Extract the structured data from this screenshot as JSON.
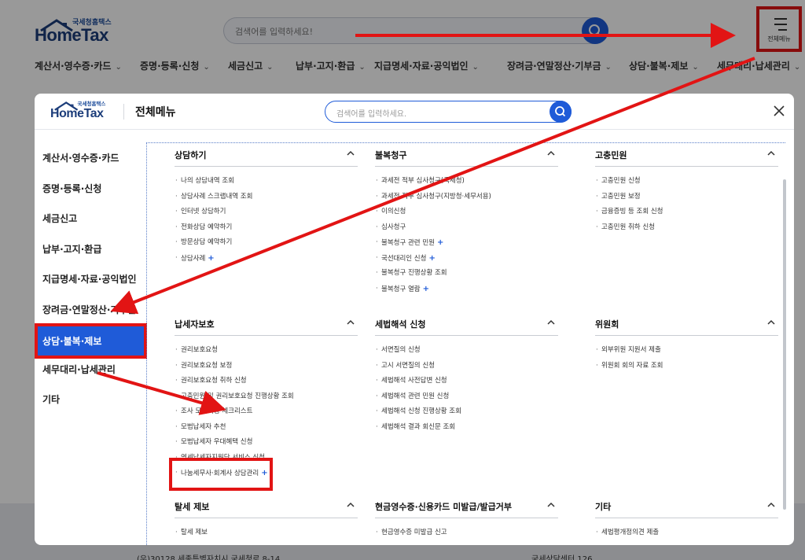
{
  "header": {
    "logo_top": "국세청홈택스",
    "logo_main": "HomeTax",
    "search_placeholder": "검색어를 입력하세요!",
    "menu_label": "전체메뉴"
  },
  "gnb": [
    {
      "label": "계산서·영수증·카드"
    },
    {
      "label": "증명·등록·신청"
    },
    {
      "label": "세금신고"
    },
    {
      "label": "납부·고지·환급"
    },
    {
      "label": "지급명세·자료·공익법인"
    },
    {
      "label": "장려금·연말정산·기부금"
    },
    {
      "label": "상담·불복·제보"
    },
    {
      "label": "세무대리·납세관리"
    }
  ],
  "footer": {
    "address": "(우)30128 세종특별자치시 국세청로 8-14",
    "center": "국세상담센터 126"
  },
  "modal": {
    "logo_top": "국세청홈택스",
    "logo_main": "HomeTax",
    "title": "전체메뉴",
    "search_placeholder": "검색어를 입력하세요."
  },
  "leftnav": [
    {
      "label": "계산서·영수증·카드",
      "active": false
    },
    {
      "label": "증명·등록·신청",
      "active": false
    },
    {
      "label": "세금신고",
      "active": false
    },
    {
      "label": "납부·고지·환급",
      "active": false
    },
    {
      "label": "지급명세·자료·공익법인",
      "active": false
    },
    {
      "label": "장려금·연말정산·기부금",
      "active": false
    },
    {
      "label": "상담·불복·제보",
      "active": true
    },
    {
      "label": "세무대리·납세관리",
      "active": false
    },
    {
      "label": "기타",
      "active": false
    }
  ],
  "sections": [
    {
      "title": "상담하기",
      "items": [
        {
          "label": "나의 상담내역 조회",
          "plus": false
        },
        {
          "label": "상담사례 스크랩내역 조회",
          "plus": false
        },
        {
          "label": "인터넷 상담하기",
          "plus": false
        },
        {
          "label": "전화상담 예약하기",
          "plus": false
        },
        {
          "label": "방문상담 예약하기",
          "plus": false
        },
        {
          "label": "상담사례",
          "plus": true
        }
      ]
    },
    {
      "title": "불복청구",
      "items": [
        {
          "label": "과세전 적부 심사청구(국세청)",
          "plus": false
        },
        {
          "label": "과세전 적부 심사청구(지방청·세무서용)",
          "plus": false
        },
        {
          "label": "이의신청",
          "plus": false
        },
        {
          "label": "심사청구",
          "plus": false
        },
        {
          "label": "불복청구 관련 민원",
          "plus": true
        },
        {
          "label": "국선대리인 신청",
          "plus": true
        },
        {
          "label": "불복청구 진행상황 조회",
          "plus": false
        },
        {
          "label": "불복청구 열람",
          "plus": true
        }
      ]
    },
    {
      "title": "고충민원",
      "items": [
        {
          "label": "고충민원 신청",
          "plus": false
        },
        {
          "label": "고충민원 보정",
          "plus": false
        },
        {
          "label": "금융증빙 등 조회 신청",
          "plus": false
        },
        {
          "label": "고충민원 취하 신청",
          "plus": false
        }
      ]
    },
    {
      "title": "납세자보호",
      "items": [
        {
          "label": "권리보호요청",
          "plus": false
        },
        {
          "label": "권리보호요청 보정",
          "plus": false
        },
        {
          "label": "권리보호요청 취하 신청",
          "plus": false
        },
        {
          "label": "고충민원 및 권리보호요청 진행상황 조회",
          "plus": false
        },
        {
          "label": "조사 모니터링 체크리스트",
          "plus": false
        },
        {
          "label": "모범납세자 추천",
          "plus": false
        },
        {
          "label": "모범납세자 우대혜택 신청",
          "plus": false
        },
        {
          "label": "영세납세자지원단 서비스 신청",
          "plus": false
        },
        {
          "label": "나눔세무사·회계사 상담관리",
          "plus": true
        }
      ]
    },
    {
      "title": "세법해석 신청",
      "items": [
        {
          "label": "서면질의 신청",
          "plus": false
        },
        {
          "label": "고시 서면질의 신청",
          "plus": false
        },
        {
          "label": "세법해석 사전답변 신청",
          "plus": false
        },
        {
          "label": "세법해석 관련 민원 신청",
          "plus": false
        },
        {
          "label": "세법해석 신청 진행상황 조회",
          "plus": false
        },
        {
          "label": "세법해석 결과 회신문 조회",
          "plus": false
        }
      ]
    },
    {
      "title": "위원회",
      "items": [
        {
          "label": "외부위원 지원서 제출",
          "plus": false
        },
        {
          "label": "위원회 회의 자료 조회",
          "plus": false
        }
      ]
    },
    {
      "title": "탈세 제보",
      "items": [
        {
          "label": "탈세 제보",
          "plus": false
        }
      ]
    },
    {
      "title": "현금영수증·신용카드 미발급/발급거부",
      "items": [
        {
          "label": "현금영수증 미발급 신고",
          "plus": false
        }
      ]
    },
    {
      "title": "기타",
      "items": [
        {
          "label": "세법평개정의견 제출",
          "plus": false
        }
      ]
    }
  ],
  "colors": {
    "primary": "#1f5bd8",
    "highlight": "#e21414",
    "logo": "#1c3d7a"
  }
}
